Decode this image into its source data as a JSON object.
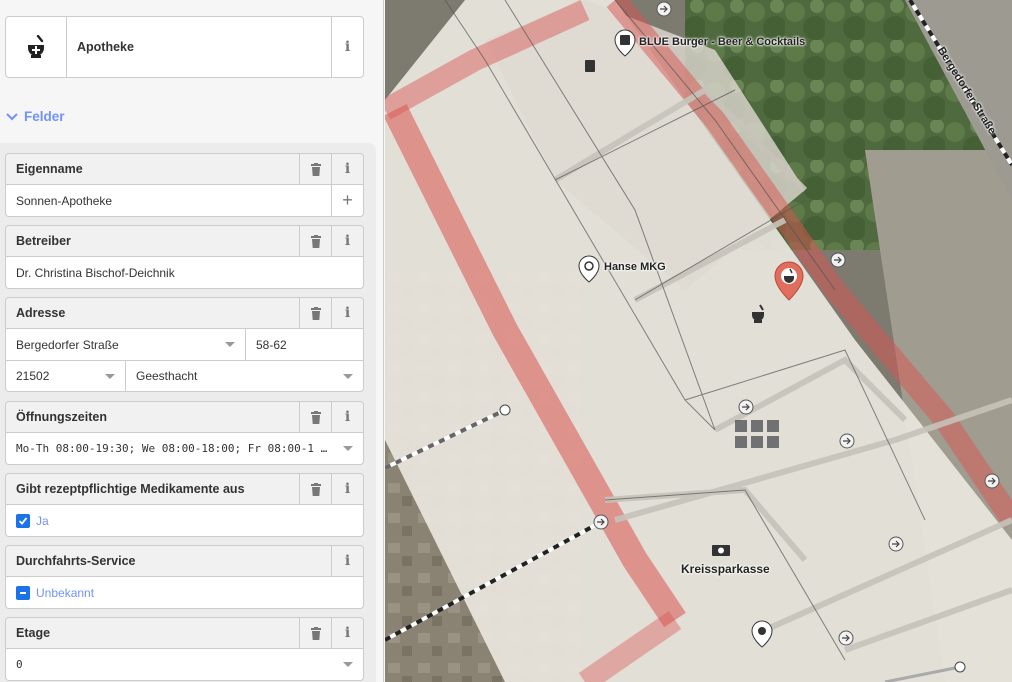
{
  "preset": {
    "name": "Apotheke",
    "icon": "mortar-pestle-icon"
  },
  "sections": {
    "fields_label": "Felder"
  },
  "fields": {
    "name": {
      "label": "Eigenname",
      "value": "Sonnen-Apotheke"
    },
    "operator": {
      "label": "Betreiber",
      "value": "Dr. Christina Bischof-Deichnik"
    },
    "address": {
      "label": "Adresse",
      "street": "Bergedorfer Straße",
      "housenumber": "58-62",
      "postcode": "21502",
      "city": "Geesthacht"
    },
    "opening_hours": {
      "label": "Öffnungszeiten",
      "value": "Mo-Th 08:00-19:30; We 08:00-18:00; Fr 08:00-1 …"
    },
    "dispensing": {
      "label": "Gibt rezeptpflichtige Medikamente aus",
      "value": "Ja",
      "checked": true
    },
    "drive_through": {
      "label": "Durchfahrts-Service",
      "value": "Unbekannt",
      "state": "indeterminate"
    },
    "level": {
      "label": "Etage",
      "value": "0"
    }
  },
  "map": {
    "labels": {
      "blue_burger": "BLUE Burger - Beer & Cocktails",
      "hanse_mkg": "Hanse MKG",
      "kreissparkasse": "Kreissparkasse",
      "street": "Bergedorfer Straße"
    },
    "colors": {
      "selected_pin": "#e06e5f",
      "area_outline": "#d9534f",
      "accent": "#7092ff"
    }
  }
}
